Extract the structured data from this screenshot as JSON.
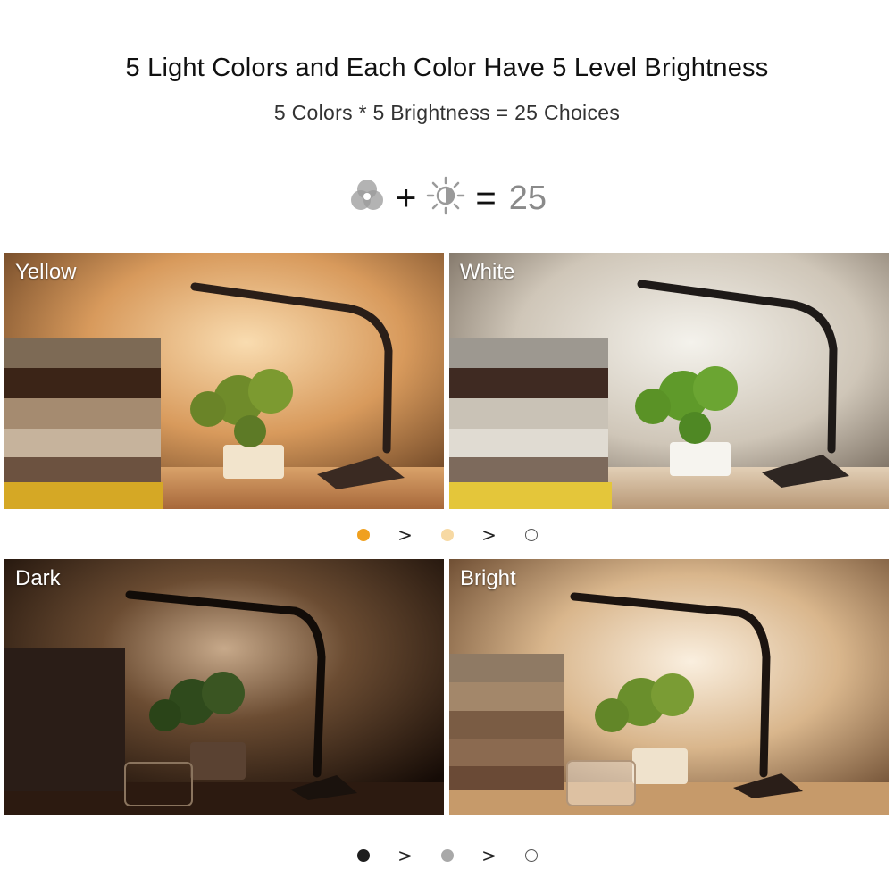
{
  "header": {
    "title": "5 Light Colors and Each Color Have 5 Level Brightness",
    "subtitle": "5 Colors * 5 Brightness = 25 Choices"
  },
  "equation": {
    "icon_1": "color-wheel-icon",
    "op_plus": "+",
    "icon_2": "sun-brightness-icon",
    "op_equals": "=",
    "result": "25"
  },
  "panels": {
    "yellow": {
      "label": "Yellow"
    },
    "white": {
      "label": "White"
    },
    "dark": {
      "label": "Dark"
    },
    "bright": {
      "label": "Bright"
    }
  },
  "color_scale": {
    "dots": [
      "#f0a01e",
      "#f7d9a3",
      "#ffffff"
    ],
    "separator": ">"
  },
  "brightness_scale": {
    "dots": [
      "#1e1e1e",
      "#a8a8a8",
      "#ffffff"
    ],
    "separator": ">"
  }
}
